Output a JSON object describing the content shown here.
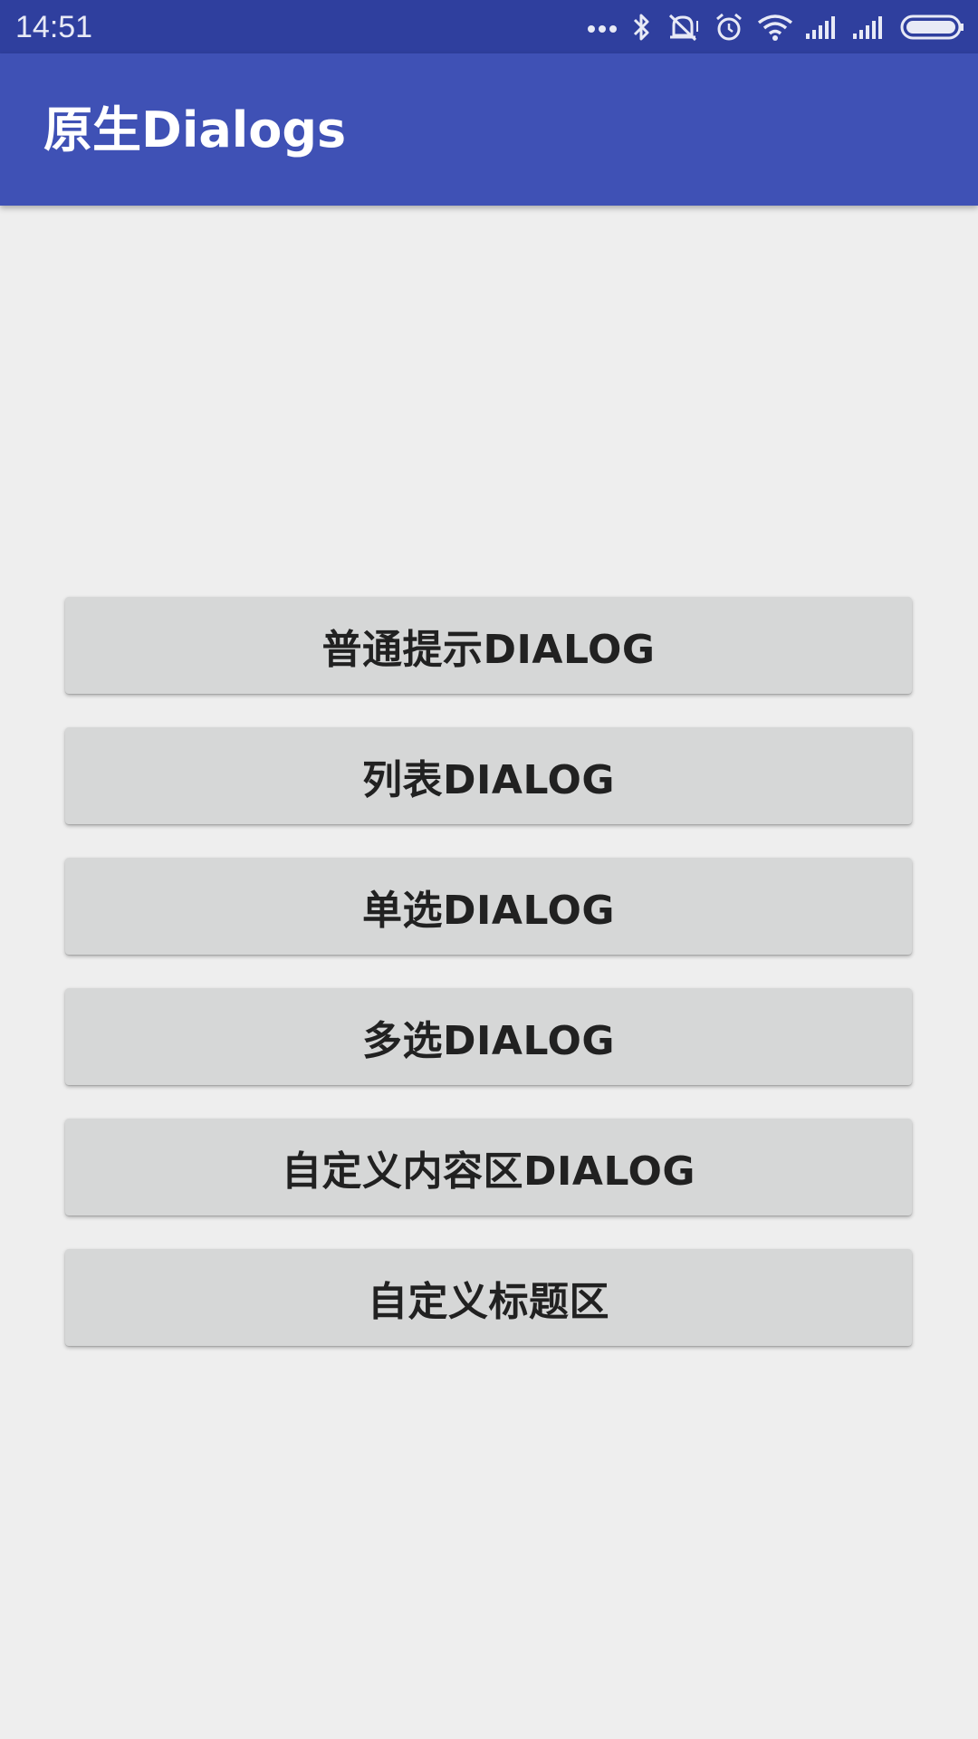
{
  "status_bar": {
    "time": "14:51",
    "icons": [
      "more-dots-icon",
      "bluetooth-icon",
      "vibrate-silent-icon",
      "alarm-icon",
      "wifi-icon",
      "signal-icon",
      "signal-icon",
      "battery-icon"
    ]
  },
  "app_bar": {
    "title": "原生Dialogs",
    "color": "#3f51b5",
    "status_color": "#2f3f9e"
  },
  "buttons": [
    {
      "label": "普通提示DIALOG"
    },
    {
      "label": "列表DIALOG"
    },
    {
      "label": "单选DIALOG"
    },
    {
      "label": "多选DIALOG"
    },
    {
      "label": "自定义内容区DIALOG"
    },
    {
      "label": "自定义标题区"
    }
  ]
}
